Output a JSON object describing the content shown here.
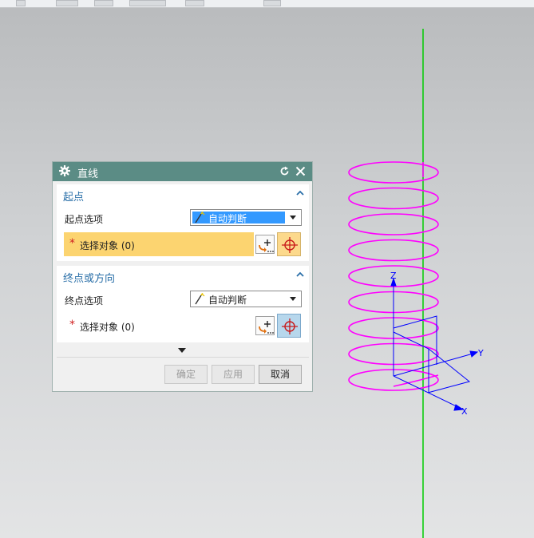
{
  "dialog": {
    "title": "直线",
    "start_section": {
      "heading": "起点",
      "option_label": "起点选项",
      "option_value": "自动判断",
      "select_label": "选择对象 (0)",
      "required_mark": "*"
    },
    "end_section": {
      "heading": "终点或方向",
      "option_label": "终点选项",
      "option_value": "自动判断",
      "select_label": "选择对象 (0)",
      "required_mark": "*"
    },
    "buttons": {
      "ok": "确定",
      "apply": "应用",
      "cancel": "取消"
    }
  },
  "viewport": {
    "axes": {
      "x": "X",
      "y": "Y",
      "z": "Z"
    },
    "helix_color": "#ff00ff",
    "vertical_line_color": "#00cc00",
    "triad_color": "#0000ff"
  },
  "colors": {
    "title_bar": "#5b8c85",
    "section_heading": "#2a6fa8",
    "highlight_row": "#fcd470",
    "selected_combo": "#3399ff"
  }
}
